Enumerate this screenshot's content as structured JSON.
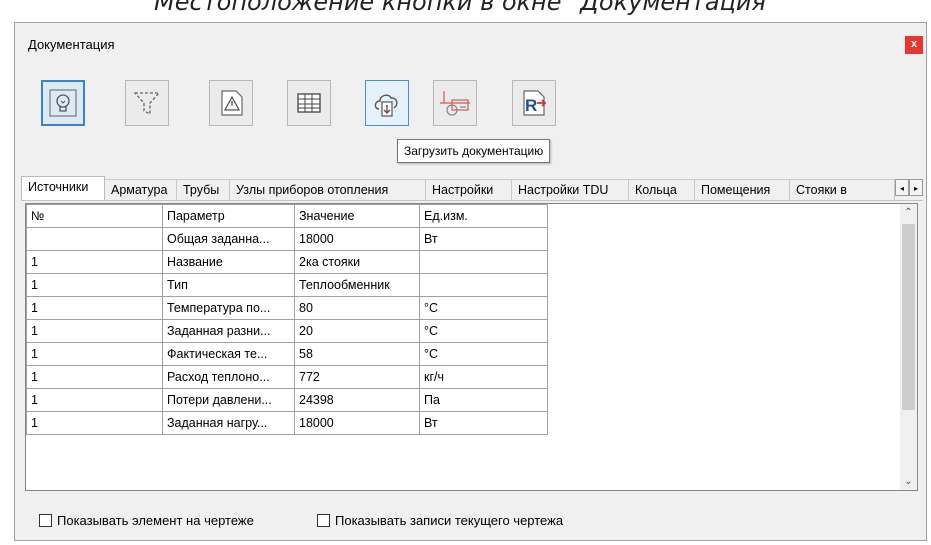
{
  "caption": "Местоположение кнопки в окне \"Документация\"",
  "window": {
    "title": "Документация",
    "close_label": "x"
  },
  "toolbar": {
    "buttons": [
      {
        "icon": "lightbulb-icon"
      },
      {
        "icon": "filter-icon"
      },
      {
        "icon": "warning-icon"
      },
      {
        "icon": "table-icon"
      },
      {
        "icon": "cloud-download-icon"
      },
      {
        "icon": "pipe-refresh-icon"
      },
      {
        "icon": "revit-export-icon"
      }
    ],
    "tooltip": "Загрузить документацию"
  },
  "tabs": [
    "Источники",
    "Арматура",
    "Трубы",
    "Узлы приборов отопления",
    "Настройки",
    "Настройки TDU",
    "Кольца",
    "Помещения",
    "Стояки в"
  ],
  "tab_scroll": {
    "left": "◂",
    "right": "▸"
  },
  "grid": {
    "headers": [
      "№",
      "Параметр",
      "Значение",
      "Ед.изм."
    ],
    "rows": [
      [
        "",
        "Общая заданна...",
        "18000",
        "Вт"
      ],
      [
        "1",
        "Название",
        "2ка стояки",
        ""
      ],
      [
        "1",
        "Тип",
        "Теплообменник",
        ""
      ],
      [
        "1",
        "Температура по...",
        "80",
        "°С"
      ],
      [
        "1",
        "Заданная разни...",
        "20",
        "°С"
      ],
      [
        "1",
        "Фактическая те...",
        "58",
        "°С"
      ],
      [
        "1",
        "Расход теплоно...",
        "772",
        "кг/ч"
      ],
      [
        "1",
        "Потери давлени...",
        "24398",
        "Па"
      ],
      [
        "1",
        "Заданная нагру...",
        "18000",
        "Вт"
      ]
    ],
    "scroll_up": "⌃",
    "scroll_down": "⌄"
  },
  "options": {
    "show_element": "Показывать элемент на чертеже",
    "show_records": "Показывать записи текущего чертежа"
  }
}
